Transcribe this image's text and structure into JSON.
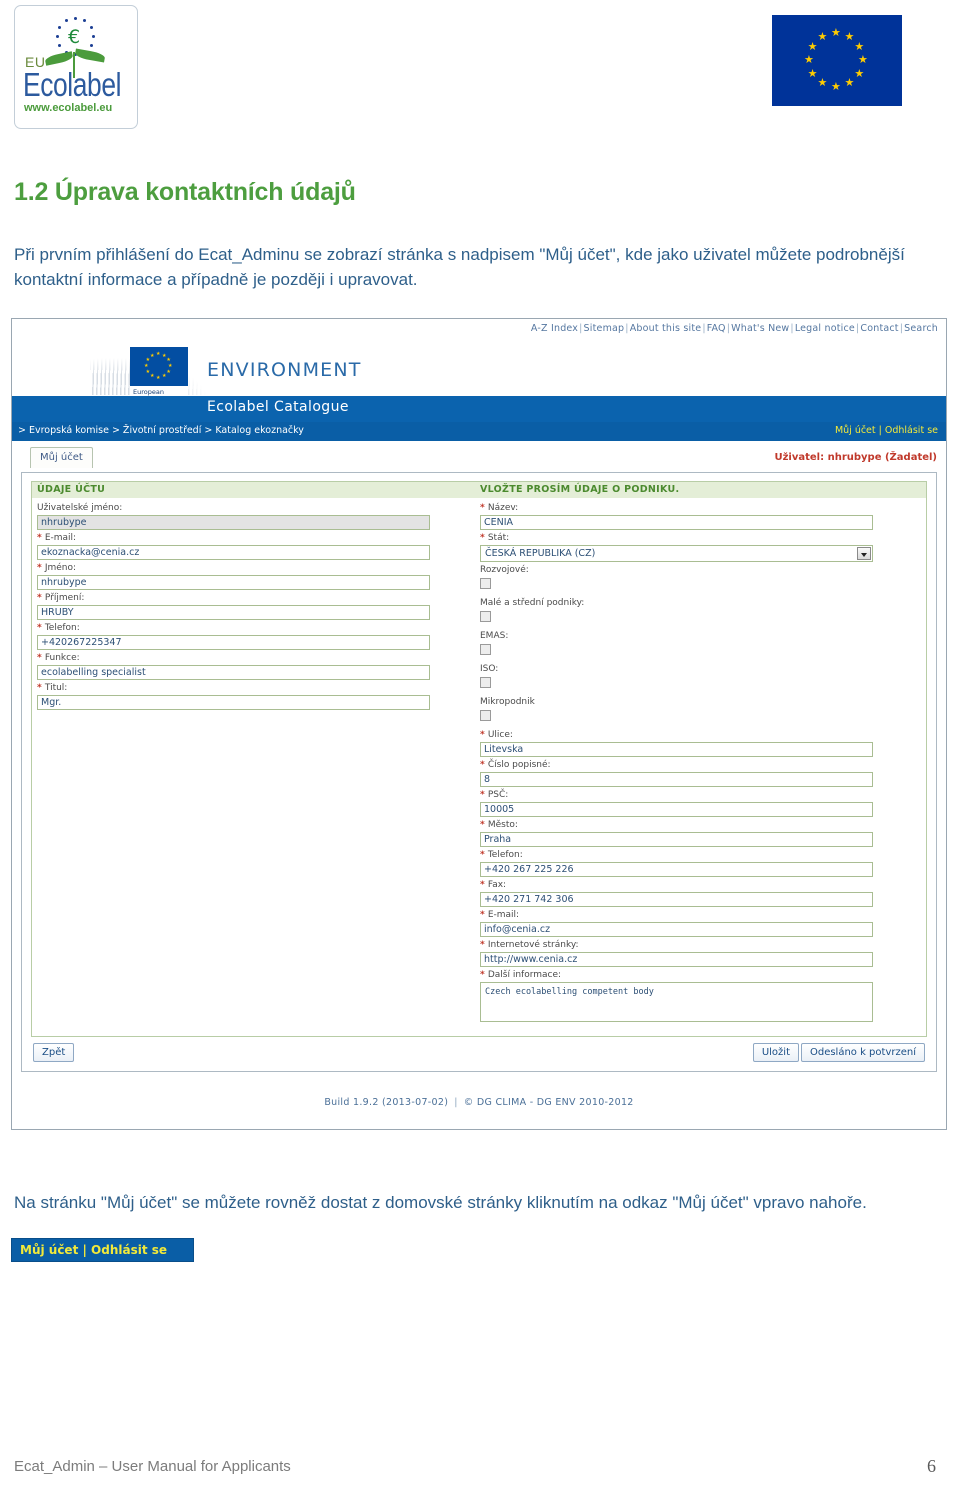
{
  "document": {
    "heading": "1.2 Úprava kontaktních údajů",
    "intro_paragraph": "Při prvním přihlášení do Ecat_Adminu se zobrazí stránka s nadpisem \"Můj účet\", kde jako uživatel můžete podrobnější kontaktní informace a případně je později i upravovat.",
    "outro_paragraph": "Na stránku \"Můj účet\" se můžete rovněž dostat z domovské stránky kliknutím na odkaz \"Můj účet\" vpravo nahoře.",
    "footer_left": "Ecat_Admin – User Manual for Applicants",
    "page_number": "6"
  },
  "logos": {
    "ecolabel_eu": "EU",
    "ecolabel_word": "Ecolabel",
    "ecolabel_url": "www.ecolabel.eu",
    "ecolabel_euro_symbol": "€"
  },
  "screenshot": {
    "top_nav": [
      "A-Z Index",
      "Sitemap",
      "About this site",
      "FAQ",
      "What's New",
      "Legal notice",
      "Contact",
      "Search"
    ],
    "ec_logo_label": "European\nCommission",
    "site_title": "ENVIRONMENT",
    "site_subtitle": "Ecolabel Catalogue",
    "breadcrumb": "> Evropská komise > Životní prostředí > Katalog ekoznačky",
    "account_links": "Můj účet | Odhlásit se",
    "tab_label": "Můj účet",
    "user_info": "Uživatel: nhrubype (Žadatel)",
    "section_left_title": "ÚDAJE ÚČTU",
    "section_right_title": "VLOŽTE PROSÍM ÚDAJE O PODNIKU.",
    "account_fields": [
      {
        "label": "Uživatelské jméno:",
        "required": false,
        "value": "nhrubype",
        "disabled": true
      },
      {
        "label": "E-mail:",
        "required": true,
        "value": "ekoznacka@cenia.cz",
        "disabled": false
      },
      {
        "label": "Jméno:",
        "required": true,
        "value": "nhrubype",
        "disabled": false
      },
      {
        "label": "Příjmení:",
        "required": true,
        "value": "HRUBY",
        "disabled": false
      },
      {
        "label": "Telefon:",
        "required": true,
        "value": "+420267225347",
        "disabled": false
      },
      {
        "label": "Funkce:",
        "required": true,
        "value": "ecolabelling specialist",
        "disabled": false
      },
      {
        "label": "Titul:",
        "required": true,
        "value": "Mgr.",
        "disabled": false
      }
    ],
    "company_name_label": "Název:",
    "company_name_value": "CENIA",
    "country_label": "Stát:",
    "country_value": "ČESKÁ REPUBLIKA (CZ)",
    "checkboxes": [
      {
        "label": "Rozvojové:",
        "checked": false
      },
      {
        "label": "Malé a střední podniky:",
        "checked": false
      },
      {
        "label": "EMAS:",
        "checked": false
      },
      {
        "label": "ISO:",
        "checked": false
      },
      {
        "label": "Mikropodnik",
        "checked": false
      }
    ],
    "address_fields": [
      {
        "label": "Ulice:",
        "required": true,
        "value": "Litevska"
      },
      {
        "label": "Číslo popisné:",
        "required": true,
        "value": "8"
      },
      {
        "label": "PSČ:",
        "required": true,
        "value": "10005"
      },
      {
        "label": "Město:",
        "required": true,
        "value": "Praha"
      },
      {
        "label": "Telefon:",
        "required": true,
        "value": "+420 267 225 226"
      },
      {
        "label": "Fax:",
        "required": true,
        "value": "+420 271 742 306"
      },
      {
        "label": "E-mail:",
        "required": true,
        "value": "info@cenia.cz"
      },
      {
        "label": "Internetové stránky:",
        "required": true,
        "value": "http://www.cenia.cz"
      }
    ],
    "more_info_label": "Další informace:",
    "more_info_value": "Czech ecolabelling competent body",
    "buttons": {
      "back": "Zpět",
      "save": "Uložit",
      "submit": "Odesláno k potvrzení"
    },
    "footer_build": "Build 1.9.2 (2013-07-02)",
    "footer_copyright": "© DG CLIMA - DG ENV 2010-2012"
  },
  "snippet": {
    "text": "Můj účet | Odhlásit se"
  },
  "colors": {
    "heading_green": "#4d9e3f",
    "body_blue": "#2e5f8a",
    "ec_blue": "#0a5ea6",
    "accent_yellow": "#f2e93a",
    "section_green": "#4b8a2e",
    "required_red": "#c0392b"
  }
}
